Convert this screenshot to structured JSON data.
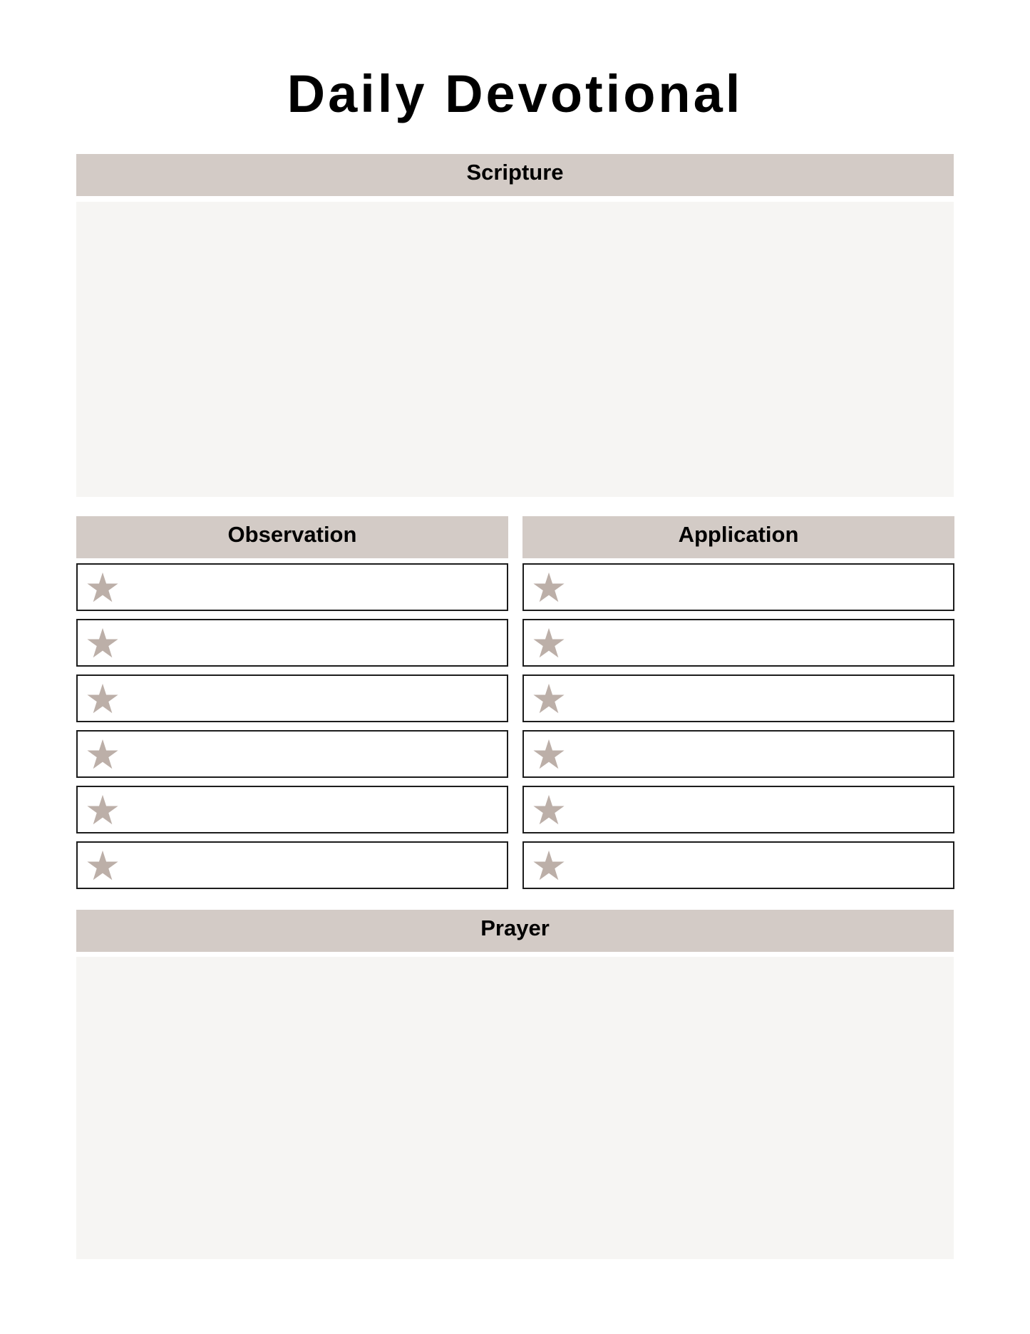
{
  "page": {
    "title": "Daily Devotional"
  },
  "colors": {
    "header_bg": "#d3cbc6",
    "box_bg": "#f6f5f3",
    "star": "#bcafa8",
    "border": "#1c1c1c"
  },
  "sections": {
    "scripture": {
      "label": "Scripture",
      "content": ""
    },
    "observation": {
      "label": "Observation",
      "bullet_icon": "star-icon",
      "items": [
        "",
        "",
        "",
        "",
        "",
        ""
      ]
    },
    "application": {
      "label": "Application",
      "bullet_icon": "star-icon",
      "items": [
        "",
        "",
        "",
        "",
        "",
        ""
      ]
    },
    "prayer": {
      "label": "Prayer",
      "content": ""
    }
  }
}
